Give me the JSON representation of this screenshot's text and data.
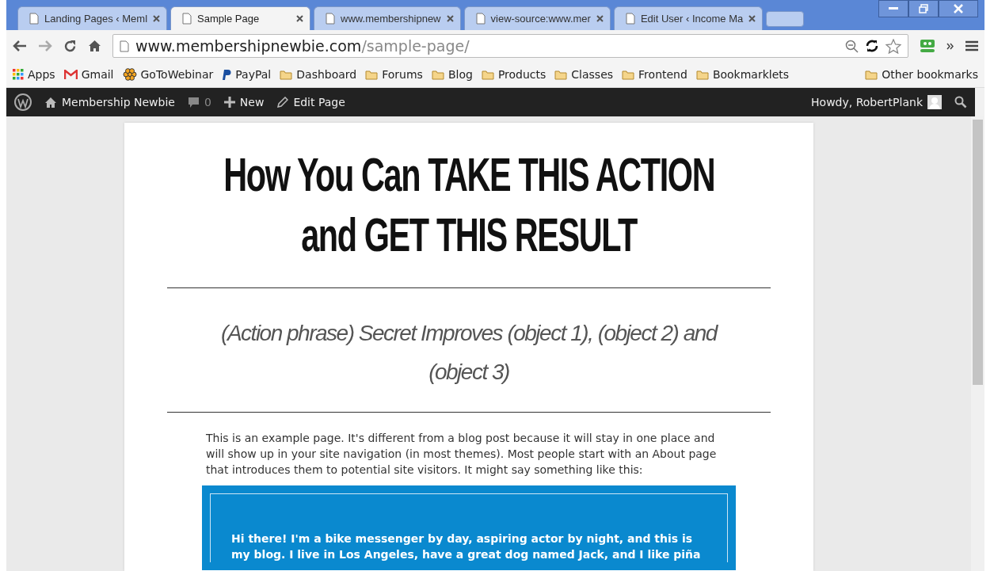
{
  "tabs": [
    {
      "label": "Landing Pages ‹ Meml",
      "selected": false
    },
    {
      "label": "Sample Page",
      "selected": true
    },
    {
      "label": "www.membershipnew",
      "selected": false
    },
    {
      "label": "view-source:www.mer",
      "selected": false
    },
    {
      "label": "Edit User ‹ Income Ma",
      "selected": false
    }
  ],
  "address_bar": {
    "host": "www.membershipnewbie.com",
    "path": "/sample-page/"
  },
  "bookmarks": [
    {
      "label": "Apps",
      "kind": "apps"
    },
    {
      "label": "Gmail",
      "kind": "gmail"
    },
    {
      "label": "GoToWebinar",
      "kind": "flower"
    },
    {
      "label": "PayPal",
      "kind": "paypal"
    },
    {
      "label": "Dashboard",
      "kind": "folder"
    },
    {
      "label": "Forums",
      "kind": "folder"
    },
    {
      "label": "Blog",
      "kind": "folder"
    },
    {
      "label": "Products",
      "kind": "folder"
    },
    {
      "label": "Classes",
      "kind": "folder"
    },
    {
      "label": "Frontend",
      "kind": "folder"
    },
    {
      "label": "Bookmarklets",
      "kind": "folder"
    }
  ],
  "other_bookmarks": "Other bookmarks",
  "admin_bar": {
    "site": "Membership Newbie",
    "comments": "0",
    "new": "New",
    "edit": "Edit Page",
    "greeting": "Howdy, RobertPlank"
  },
  "page": {
    "title_lines": [
      "How You Can TAKE THIS ACTION",
      "and GET THIS RESULT"
    ],
    "subtitle": "(Action phrase) Secret Improves (object 1), (object 2) and (object 3)",
    "body": "This is an example page. It's different from a blog post because it will stay in one place and will show up in your site navigation (in most themes). Most people start with an About page that introduces them to potential site visitors. It might say something like this:",
    "quote": "Hi there! I'm a bike messenger by day, aspiring actor by night, and this is my blog. I live in Los Angeles, have a great dog named Jack, and I like piña"
  }
}
